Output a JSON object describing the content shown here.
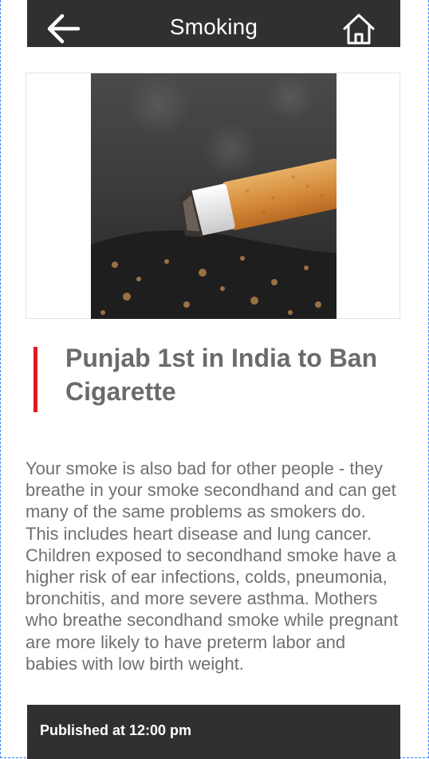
{
  "header": {
    "title": "Smoking",
    "back_icon": "arrow-left-icon",
    "home_icon": "home-icon"
  },
  "article": {
    "image": "cigarette-photo",
    "headline": "Punjab 1st in India to Ban Cigarette",
    "body": "Your smoke is also bad for other people - they breathe in your smoke secondhand and can get many of the same problems as smokers do. This includes heart disease and lung cancer. Children exposed to secondhand smoke have a higher risk of ear infections, colds, pneumonia, bronchitis, and more severe asthma. Mothers who breathe secondhand smoke while pregnant are more likely to have preterm labor and babies with low birth weight.",
    "accent_color": "#e11b22"
  },
  "footer": {
    "published": "Published at 12:00 pm"
  },
  "colors": {
    "bar": "#303032",
    "text_gray": "#707070"
  }
}
